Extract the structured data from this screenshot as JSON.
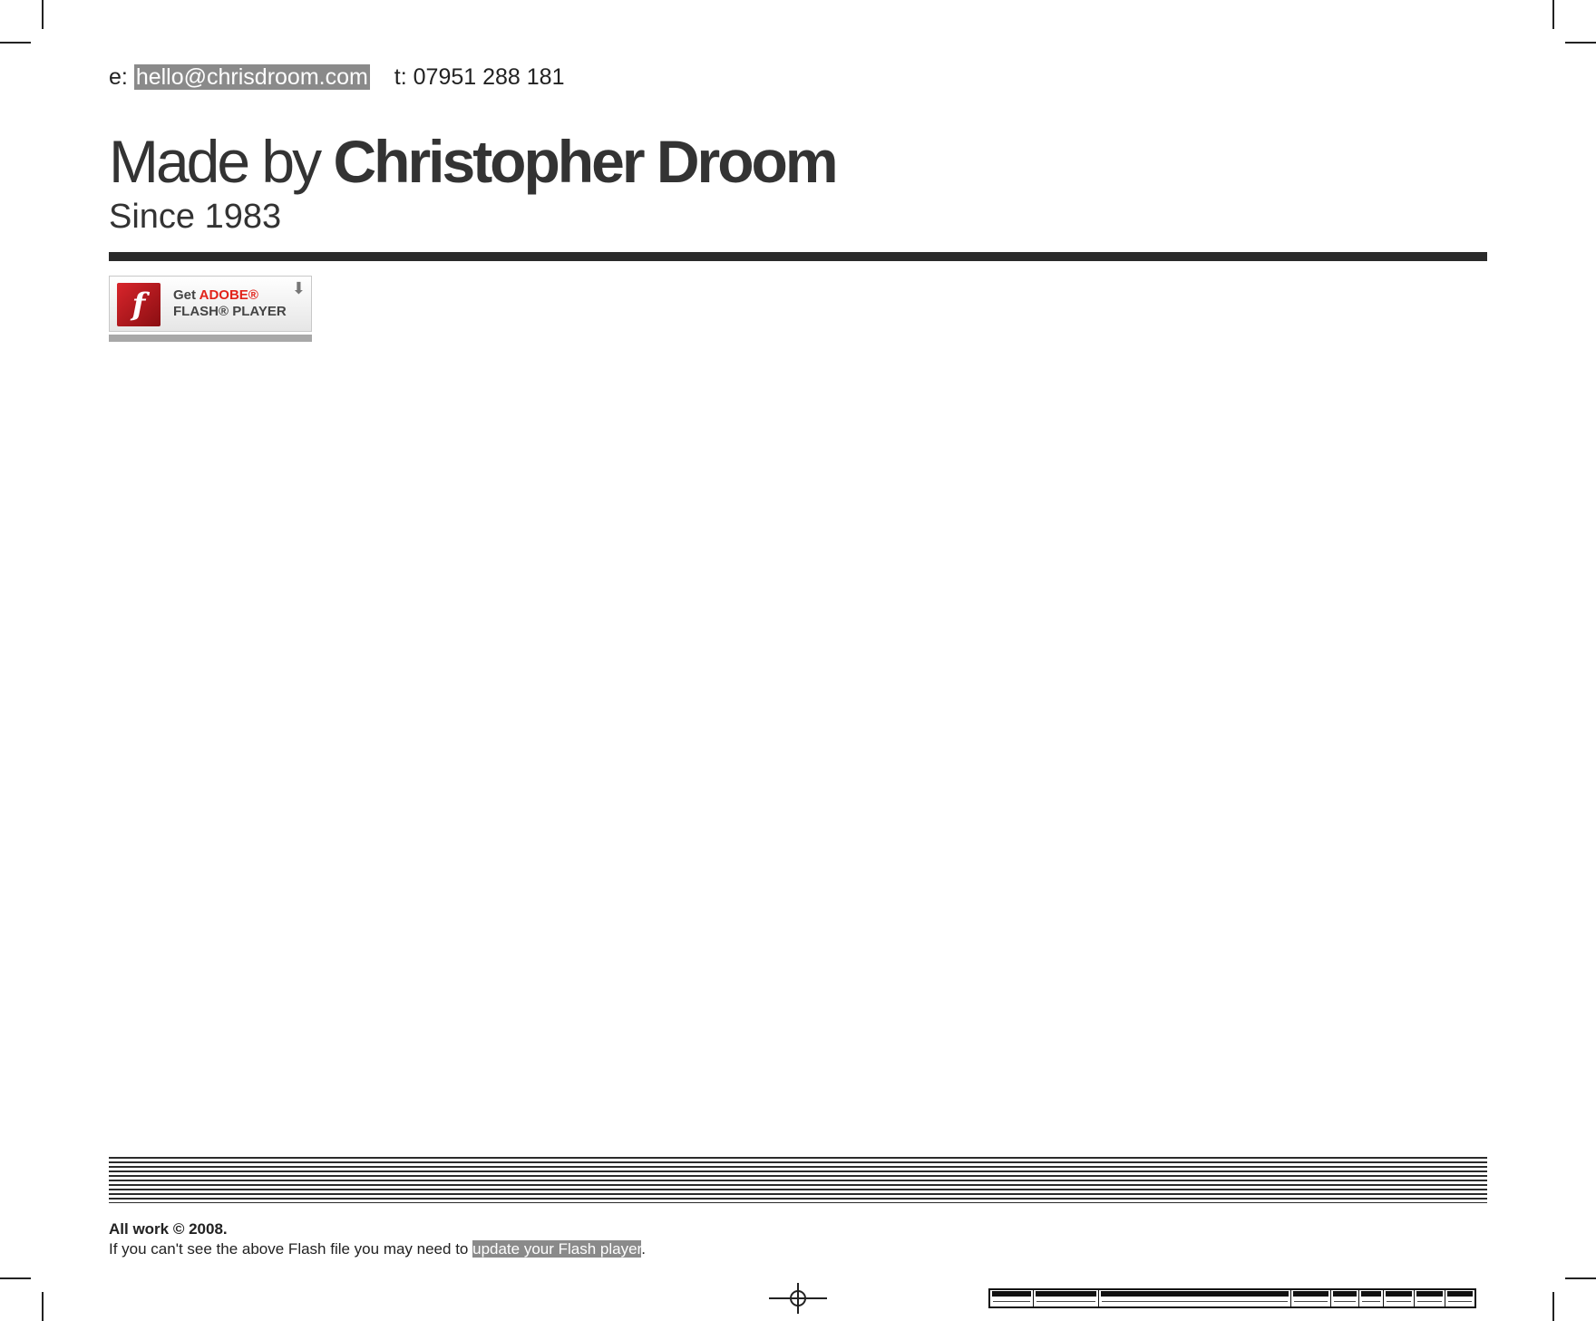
{
  "contact": {
    "email_prefix": "e:",
    "email": "hello@chrisdroom.com",
    "phone": "t: 07951 288 181"
  },
  "header": {
    "title_prefix": "Made by",
    "title_name": "Christopher Droom",
    "subtitle": "Since 1983"
  },
  "flash_badge": {
    "get": "Get",
    "adobe": "ADOBE",
    "reg_mark": "®",
    "flash_player": "FLASH® PLAYER",
    "logo_letter": "f",
    "download_glyph": "⬇",
    "icon": "adobe-flash-icon",
    "accent_color": "#e2231a"
  },
  "footer": {
    "copyright": "All work © 2008.",
    "notice_text": "If you can't see the above Flash file you may need to",
    "update_link": "update your Flash player",
    "end_punct": "."
  },
  "colors": {
    "text": "#333333",
    "link_highlight": "#8a8a8a",
    "rule": "#2b2b2b"
  }
}
